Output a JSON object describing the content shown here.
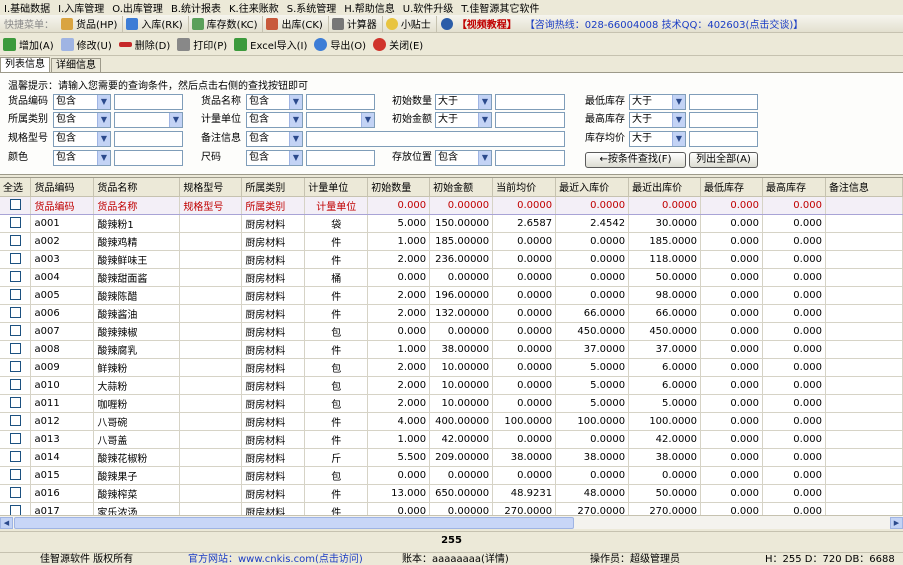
{
  "menu": [
    "I.基础数据",
    "I.入库管理",
    "O.出库管理",
    "B.统计报表",
    "K.往来账款",
    "S.系统管理",
    "H.帮助信息",
    "U.软件升级",
    "T.佳智源其它软件"
  ],
  "quickbar": {
    "label": "快捷菜单：",
    "buttons": [
      "货品(HP)",
      "入库(RK)",
      "库存数(KC)",
      "出库(CK)",
      "计算器",
      "小贴士"
    ],
    "video": "【视频教程】",
    "hotline": "【咨询热线：028-66004008  技术QQ：402603(点击交谈)】"
  },
  "toolbar": [
    "增加(A)",
    "修改(U)",
    "删除(D)",
    "打印(P)",
    "Excel导入(I)",
    "导出(O)",
    "关闭(E)"
  ],
  "tabs": [
    "列表信息",
    "详细信息"
  ],
  "hint": "温馨提示：请输入您需要的查询条件，然后点击右侧的查找按钮即可",
  "filters": {
    "col1": [
      "货品编码",
      "所属类别",
      "规格型号",
      "颜色"
    ],
    "col2": [
      "货品名称",
      "计量单位",
      "备注信息",
      "尺码"
    ],
    "col3": [
      "初始数量",
      "初始金额",
      "存放位置"
    ],
    "col4": [
      "最低库存",
      "最高库存",
      "库存均价"
    ],
    "contains": "包含",
    "greater": "大于",
    "search_btn": "←按条件查找(F)",
    "list_all_btn": "列出全部(A)"
  },
  "grid": {
    "headers": [
      "全选",
      "货品编码",
      "货品名称",
      "规格型号",
      "所属类别",
      "计量单位",
      "初始数量",
      "初始金额",
      "当前均价",
      "最近入库价",
      "最近出库价",
      "最低库存",
      "最高库存",
      "备注信息"
    ],
    "header_row": [
      "",
      "货品编码",
      "货品名称",
      "规格型号",
      "所属类别",
      "计量单位",
      "0.000",
      "0.00000",
      "0.0000",
      "0.0000",
      "0.0000",
      "0.000",
      "0.000",
      ""
    ],
    "rows": [
      [
        "a001",
        "酸辣粉1",
        "",
        "厨房材料",
        "袋",
        "5.000",
        "150.00000",
        "2.6587",
        "2.4542",
        "30.0000",
        "0.000",
        "0.000"
      ],
      [
        "a002",
        "酸辣鸡精",
        "",
        "厨房材料",
        "件",
        "1.000",
        "185.00000",
        "0.0000",
        "0.0000",
        "185.0000",
        "0.000",
        "0.000"
      ],
      [
        "a003",
        "酸辣鲜味王",
        "",
        "厨房材料",
        "件",
        "2.000",
        "236.00000",
        "0.0000",
        "0.0000",
        "118.0000",
        "0.000",
        "0.000"
      ],
      [
        "a004",
        "酸辣甜面酱",
        "",
        "厨房材料",
        "桶",
        "0.000",
        "0.00000",
        "0.0000",
        "0.0000",
        "50.0000",
        "0.000",
        "0.000"
      ],
      [
        "a005",
        "酸辣陈醋",
        "",
        "厨房材料",
        "件",
        "2.000",
        "196.00000",
        "0.0000",
        "0.0000",
        "98.0000",
        "0.000",
        "0.000"
      ],
      [
        "a006",
        "酸辣酱油",
        "",
        "厨房材料",
        "件",
        "2.000",
        "132.00000",
        "0.0000",
        "66.0000",
        "66.0000",
        "0.000",
        "0.000"
      ],
      [
        "a007",
        "酸辣辣椒",
        "",
        "厨房材料",
        "包",
        "0.000",
        "0.00000",
        "0.0000",
        "450.0000",
        "450.0000",
        "0.000",
        "0.000"
      ],
      [
        "a008",
        "酸辣腐乳",
        "",
        "厨房材料",
        "件",
        "1.000",
        "38.00000",
        "0.0000",
        "37.0000",
        "37.0000",
        "0.000",
        "0.000"
      ],
      [
        "a009",
        "鲜辣粉",
        "",
        "厨房材料",
        "包",
        "2.000",
        "10.00000",
        "0.0000",
        "5.0000",
        "6.0000",
        "0.000",
        "0.000"
      ],
      [
        "a010",
        "大蒜粉",
        "",
        "厨房材料",
        "包",
        "2.000",
        "10.00000",
        "0.0000",
        "5.0000",
        "6.0000",
        "0.000",
        "0.000"
      ],
      [
        "a011",
        "咖喱粉",
        "",
        "厨房材料",
        "包",
        "2.000",
        "10.00000",
        "0.0000",
        "5.0000",
        "5.0000",
        "0.000",
        "0.000"
      ],
      [
        "a012",
        "八哥碗",
        "",
        "厨房材料",
        "件",
        "4.000",
        "400.00000",
        "100.0000",
        "100.0000",
        "100.0000",
        "0.000",
        "0.000"
      ],
      [
        "a013",
        "八哥盖",
        "",
        "厨房材料",
        "件",
        "1.000",
        "42.00000",
        "0.0000",
        "0.0000",
        "42.0000",
        "0.000",
        "0.000"
      ],
      [
        "a014",
        "酸辣花椒粉",
        "",
        "厨房材料",
        "斤",
        "5.500",
        "209.00000",
        "38.0000",
        "38.0000",
        "38.0000",
        "0.000",
        "0.000"
      ],
      [
        "a015",
        "酸辣果子",
        "",
        "厨房材料",
        "包",
        "0.000",
        "0.00000",
        "0.0000",
        "0.0000",
        "0.0000",
        "0.000",
        "0.000"
      ],
      [
        "a016",
        "酸辣榨菜",
        "",
        "厨房材料",
        "件",
        "13.000",
        "650.00000",
        "48.9231",
        "48.0000",
        "50.0000",
        "0.000",
        "0.000"
      ],
      [
        "a017",
        "家乐浓汤",
        "",
        "厨房材料",
        "件",
        "0.000",
        "0.00000",
        "270.0000",
        "270.0000",
        "270.0000",
        "0.000",
        "0.000"
      ]
    ]
  },
  "record_count": "255",
  "status": {
    "company": "佳智源软件 版权所有",
    "website": "官方网站：www.cnkis.com(点击访问)",
    "account": "账本：aaaaaaaa(详情)",
    "operator": "操作员：超级管理员",
    "stats": "H：255 D：720 DB：6688"
  }
}
